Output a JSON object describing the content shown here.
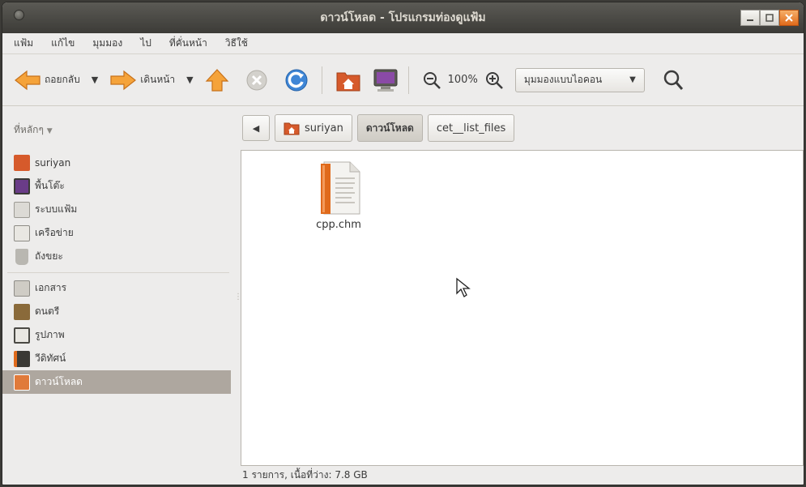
{
  "window": {
    "title": "ดาวน์โหลด - โปรแกรมท่องดูแฟ้ม",
    "controls": [
      "minimize",
      "maximize",
      "close"
    ]
  },
  "menu": {
    "items": [
      "แฟ้ม",
      "แก้ไข",
      "มุมมอง",
      "ไป",
      "ที่คั่นหน้า",
      "วิธีใช้"
    ]
  },
  "toolbar": {
    "back_label": "ถอยกลับ",
    "forward_label": "เดินหน้า",
    "zoom_value": "100%",
    "view_mode": "มุมมองแบบไอคอน",
    "icons": [
      "back-arrow-icon",
      "forward-arrow-icon",
      "up-arrow-icon",
      "stop-icon",
      "reload-icon",
      "home-icon",
      "computer-icon",
      "zoom-out-icon",
      "zoom-in-icon",
      "search-icon"
    ]
  },
  "sidebar": {
    "header": "ที่หลักๆ",
    "items": [
      {
        "label": "suriyan",
        "icon": "home-folder-icon"
      },
      {
        "label": "พื้นโต๊ะ",
        "icon": "desktop-icon"
      },
      {
        "label": "ระบบแฟ้ม",
        "icon": "filesystem-icon"
      },
      {
        "label": "เครือข่าย",
        "icon": "network-icon"
      },
      {
        "label": "ถังขยะ",
        "icon": "trash-icon"
      },
      {
        "label": "เอกสาร",
        "icon": "documents-folder-icon"
      },
      {
        "label": "ดนตรี",
        "icon": "music-folder-icon"
      },
      {
        "label": "รูปภาพ",
        "icon": "pictures-folder-icon"
      },
      {
        "label": "วีดิทัศน์",
        "icon": "videos-folder-icon"
      },
      {
        "label": "ดาวน์โหลด",
        "icon": "downloads-folder-icon"
      }
    ],
    "active_index": 9
  },
  "pathbar": {
    "crumbs": [
      "suriyan",
      "ดาวน์โหลด",
      "cet__list_files"
    ],
    "active_index": 1
  },
  "files": [
    {
      "name": "cpp.chm",
      "icon": "chm-document-icon"
    }
  ],
  "status": {
    "text": "1 รายการ, เนื้อที่ว่าง: 7.8 GB"
  },
  "colors": {
    "titlebar": "#3c3b37",
    "accent_orange": "#e06a1b",
    "selection": "#aea79f"
  }
}
